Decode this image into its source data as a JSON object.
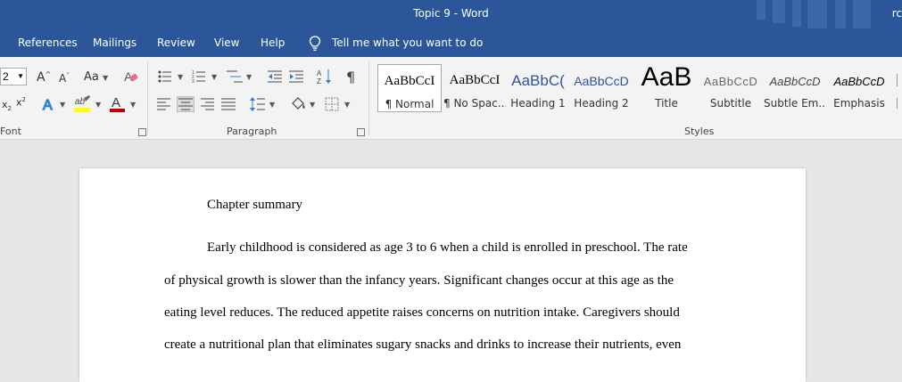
{
  "titlebar": {
    "title": "Topic 9  -  Word",
    "user": "rc"
  },
  "menu": {
    "tabs": [
      "References",
      "Mailings",
      "Review",
      "View",
      "Help"
    ],
    "tell_me": "Tell me what you want to do"
  },
  "ribbon": {
    "font_size": "2",
    "groups": {
      "font": "Font",
      "paragraph": "Paragraph",
      "styles": "Styles"
    },
    "font_tools": {
      "grow": "A",
      "shrink": "A",
      "change_case": "Aa",
      "subscript": "x",
      "superscript": "x",
      "highlight": "ab",
      "font_color": "A"
    },
    "styles": [
      {
        "sample": "AaBbCcI",
        "label": "¶ Normal"
      },
      {
        "sample": "AaBbCcI",
        "label": "¶ No Spac..."
      },
      {
        "sample": "AaBbC(",
        "label": "Heading 1"
      },
      {
        "sample": "AaBbCcD",
        "label": "Heading 2"
      },
      {
        "sample": "AaB",
        "label": "Title"
      },
      {
        "sample": "AaBbCcD",
        "label": "Subtitle"
      },
      {
        "sample": "AaBbCcD",
        "label": "Subtle Em..."
      },
      {
        "sample": "AaBbCcD",
        "label": "Emphasis"
      }
    ],
    "colors": {
      "highlight": "#ffff00",
      "font_color": "#c00000"
    }
  },
  "document": {
    "heading": "Chapter summary",
    "lines": [
      "Early childhood is considered as age 3 to 6 when a child is enrolled in preschool. The rate",
      "of physical growth is slower than the infancy years. Significant changes occur at this age as the",
      "eating level reduces. The reduced appetite raises concerns on nutrition intake. Caregivers should",
      "create a nutritional plan that eliminates sugary snacks and drinks to increase their nutrients, even"
    ]
  }
}
